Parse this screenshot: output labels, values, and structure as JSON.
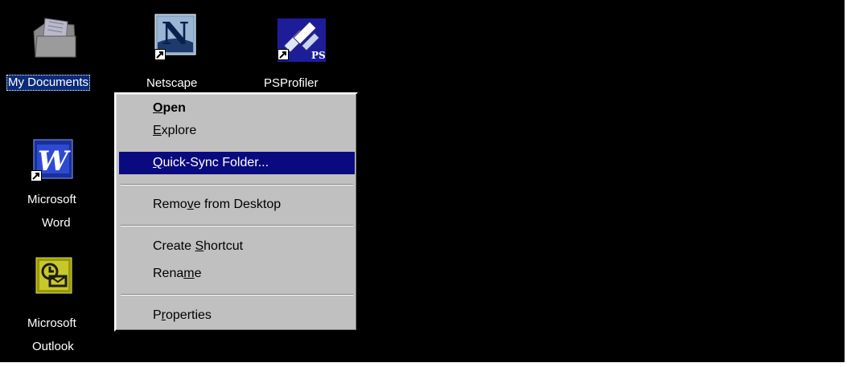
{
  "desktop": {
    "background_color": "#000000",
    "icons": [
      {
        "id": "my_documents",
        "label": "My Documents",
        "selected": true,
        "icon": "my-documents-icon"
      },
      {
        "id": "netscape",
        "label": "Netscape",
        "selected": false,
        "icon": "netscape-icon",
        "shortcut": true
      },
      {
        "id": "psprofiler",
        "label": "PSProfiler",
        "selected": false,
        "icon": "psprofiler-icon",
        "shortcut": true
      },
      {
        "id": "word",
        "label_line1": "Microsoft",
        "label_line2": "Word",
        "selected": false,
        "icon": "word-icon",
        "shortcut": true
      },
      {
        "id": "outlook",
        "label_line1": "Microsoft",
        "label_line2": "Outlook",
        "selected": false,
        "icon": "outlook-icon"
      }
    ]
  },
  "context_menu": {
    "items": [
      {
        "label": "Open",
        "default": true,
        "underline": "O"
      },
      {
        "label": "Explore",
        "underline": "E"
      },
      {
        "label": "Quick-Sync Folder...",
        "underline": "Q",
        "highlighted": true
      },
      {
        "label": "Remove from Desktop",
        "underline": "v"
      },
      {
        "label": "Create Shortcut",
        "underline": "S"
      },
      {
        "label": "Rename",
        "underline": "m"
      },
      {
        "label": "Properties",
        "underline": "r"
      }
    ]
  },
  "icon_text": {
    "netscape_letter": "N",
    "psprofiler_badge": "PS",
    "word_letter": "W"
  }
}
